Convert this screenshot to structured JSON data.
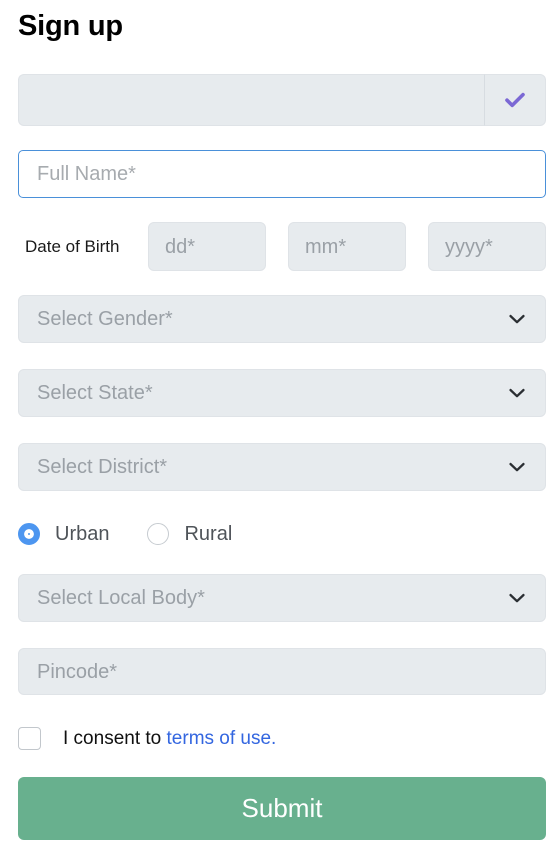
{
  "page": {
    "title": "Sign up"
  },
  "colors": {
    "field_background": "#e7ebee",
    "field_border": "#dfe3e7",
    "focus_border": "#4a90d9",
    "verify_check": "#7b68d4",
    "radio_selected": "#4d96f0",
    "link": "#3366e0",
    "submit_background": "#68b08e",
    "submit_text": "#ffffff",
    "placeholder_text": "#9aa0a6"
  },
  "form": {
    "verify": {
      "value": "",
      "placeholder": "",
      "icon": "check-icon",
      "button_label": ""
    },
    "full_name": {
      "value": "",
      "placeholder": "Full Name*",
      "focused": true
    },
    "date_of_birth": {
      "label": "Date of Birth",
      "day": {
        "value": "",
        "placeholder": "dd*"
      },
      "month": {
        "value": "",
        "placeholder": "mm*"
      },
      "year": {
        "value": "",
        "placeholder": "yyyy*"
      }
    },
    "gender": {
      "selected_label": "Select Gender*",
      "icon": "chevron-down-icon"
    },
    "state": {
      "selected_label": "Select State*",
      "icon": "chevron-down-icon"
    },
    "district": {
      "selected_label": "Select District*",
      "icon": "chevron-down-icon"
    },
    "area_type": {
      "selected": "Urban",
      "options": [
        {
          "label": "Urban",
          "checked": true
        },
        {
          "label": "Rural",
          "checked": false
        }
      ]
    },
    "local_body": {
      "selected_label": "Select Local Body*",
      "icon": "chevron-down-icon"
    },
    "pincode": {
      "value": "",
      "placeholder": "Pincode*"
    },
    "consent": {
      "checked": false,
      "text": "I consent to",
      "link_text": "terms of use."
    },
    "submit": {
      "label": "Submit"
    }
  }
}
